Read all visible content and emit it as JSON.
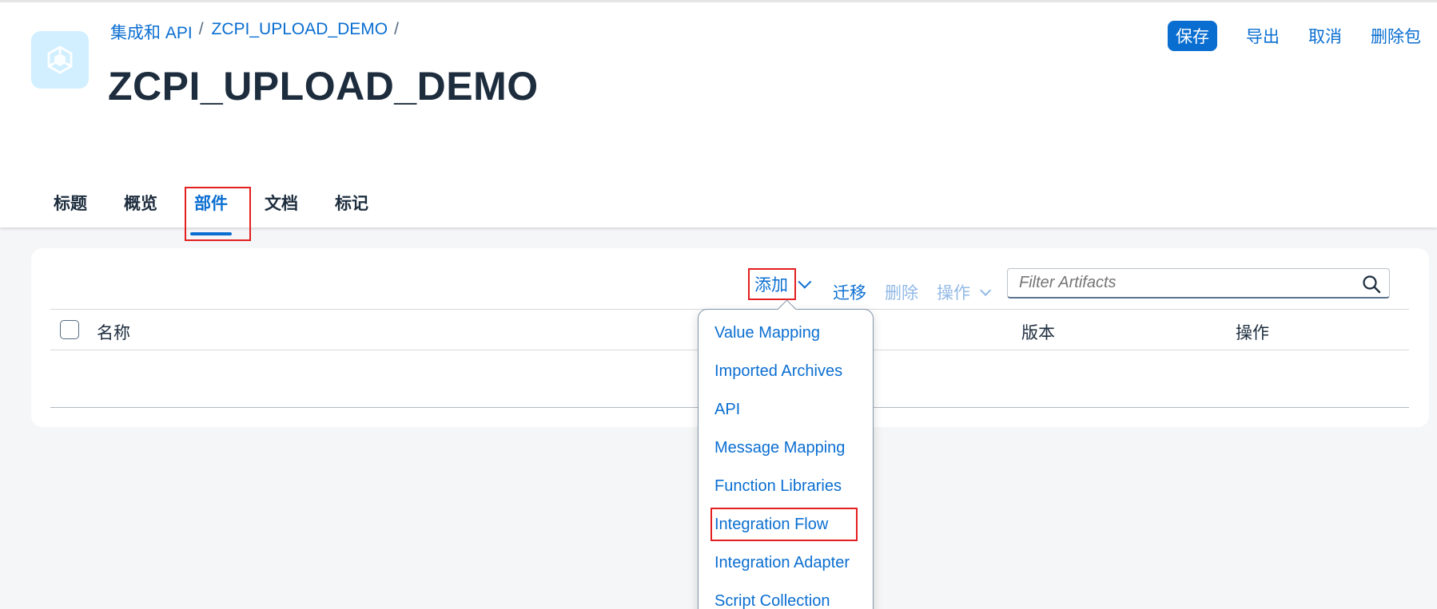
{
  "breadcrumb": {
    "items": [
      {
        "label": "集成和 API",
        "sep": "/"
      },
      {
        "label": "ZCPI_UPLOAD_DEMO",
        "sep": "/"
      }
    ]
  },
  "page": {
    "title": "ZCPI_UPLOAD_DEMO",
    "icon": "cube-package-icon"
  },
  "actions": {
    "save": "保存",
    "export": "导出",
    "cancel": "取消",
    "delete_package": "删除包"
  },
  "tabs": [
    {
      "label": "标题"
    },
    {
      "label": "概览"
    },
    {
      "label": "部件",
      "active": true
    },
    {
      "label": "文档"
    },
    {
      "label": "标记"
    }
  ],
  "toolbar": {
    "add": "添加",
    "migrate": "迁移",
    "delete": "删除",
    "actions": "操作",
    "search_placeholder": "Filter Artifacts"
  },
  "table": {
    "columns": [
      "名称",
      "版本",
      "操作"
    ]
  },
  "add_menu": {
    "items": [
      "Value Mapping",
      "Imported Archives",
      "API",
      "Message Mapping",
      "Function Libraries",
      "Integration Flow",
      "Integration Adapter",
      "Script Collection"
    ]
  },
  "colors": {
    "accent": "#0a6ed1",
    "highlight": "#e41f1f",
    "disabled": "#92b9e6"
  }
}
